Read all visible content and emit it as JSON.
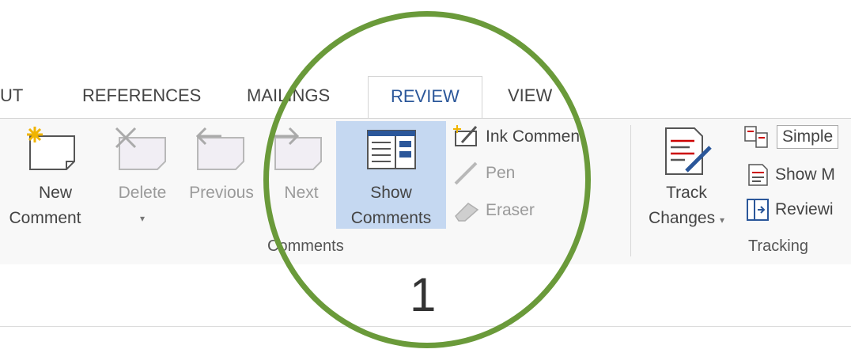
{
  "tabs": [
    {
      "label": "UT"
    },
    {
      "label": "REFERENCES"
    },
    {
      "label": "MAILINGS"
    },
    {
      "label": "REVIEW"
    },
    {
      "label": "VIEW"
    }
  ],
  "comments_group": {
    "new_comment": {
      "line1": "New",
      "line2": "Comment"
    },
    "delete": {
      "label": "Delete",
      "dropdown": "▾"
    },
    "previous": {
      "label": "Previous"
    },
    "next": {
      "label": "Next"
    },
    "show_comments": {
      "line1": "Show",
      "line2": "Comments"
    },
    "ink_comment": {
      "label": "Ink Comment"
    },
    "pen": {
      "label": "Pen"
    },
    "eraser": {
      "label": "Eraser"
    },
    "group_label": "Comments"
  },
  "tracking_group": {
    "track_changes": {
      "line1": "Track",
      "line2": "Changes",
      "dropdown": "▾"
    },
    "simple_markup": {
      "label": "Simple"
    },
    "show_markup": {
      "label": "Show M"
    },
    "reviewing_pane": {
      "label": "Reviewi"
    },
    "group_label": "Tracking"
  },
  "callout": {
    "number": "1"
  },
  "colors": {
    "accent": "#2b579a",
    "highlight": "#c5d8f1",
    "circle": "#6a9a3a"
  }
}
